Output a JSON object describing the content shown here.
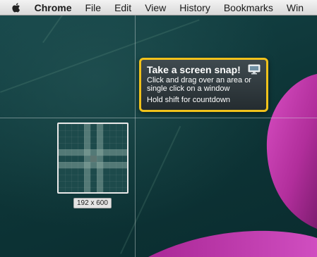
{
  "menubar": {
    "apple_icon": "apple-icon",
    "items": [
      {
        "label": "Chrome",
        "bold": true
      },
      {
        "label": "File"
      },
      {
        "label": "Edit"
      },
      {
        "label": "View"
      },
      {
        "label": "History"
      },
      {
        "label": "Bookmarks"
      },
      {
        "label": "Win"
      }
    ]
  },
  "magnifier": {
    "dimensions": "192 x 600"
  },
  "tooltip": {
    "title": "Take a screen snap!",
    "line1": "Click and drag over an area or",
    "line2": "single click on a window",
    "line3": "Hold shift for countdown",
    "icon": "monitor-icon",
    "border_color": "#f1c21b"
  },
  "colors": {
    "petal": "#b8309f",
    "desktop": "#0f3a3b"
  }
}
